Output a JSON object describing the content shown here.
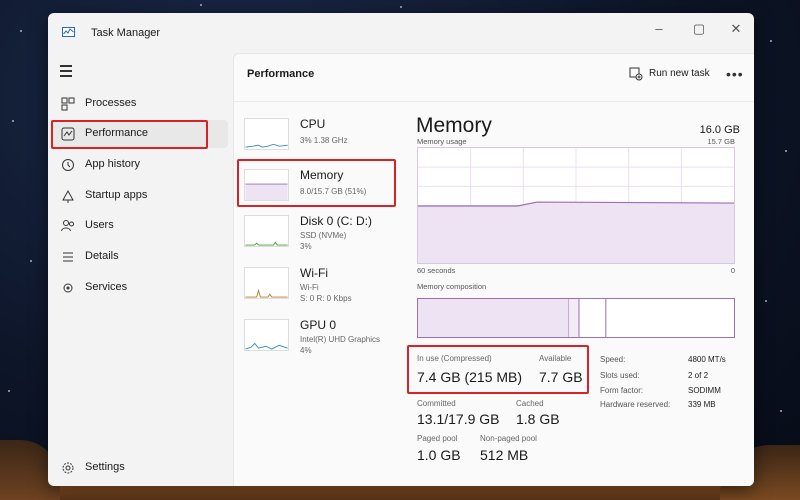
{
  "window": {
    "title": "Task Manager"
  },
  "nav": {
    "items": [
      {
        "label": "Processes",
        "icon": "processes-icon"
      },
      {
        "label": "Performance",
        "icon": "performance-icon"
      },
      {
        "label": "App history",
        "icon": "history-icon"
      },
      {
        "label": "Startup apps",
        "icon": "startup-icon"
      },
      {
        "label": "Users",
        "icon": "users-icon"
      },
      {
        "label": "Details",
        "icon": "details-icon"
      },
      {
        "label": "Services",
        "icon": "services-icon"
      }
    ],
    "settings": "Settings",
    "active": "Performance"
  },
  "header": {
    "title": "Performance",
    "run_task": "Run new task",
    "more": "•••"
  },
  "perf_list": [
    {
      "name": "CPU",
      "sub": [
        "3% 1.38 GHz"
      ]
    },
    {
      "name": "Memory",
      "sub": [
        "8.0/15.7 GB (51%)"
      ]
    },
    {
      "name": "Disk 0 (C: D:)",
      "sub": [
        "SSD (NVMe)",
        "3%"
      ]
    },
    {
      "name": "Wi-Fi",
      "sub": [
        "Wi-Fi",
        "S: 0 R: 0 Kbps"
      ]
    },
    {
      "name": "GPU 0",
      "sub": [
        "Intel(R) UHD Graphics",
        "4%"
      ]
    }
  ],
  "memory": {
    "title": "Memory",
    "total": "16.0 GB",
    "usage_label": "Memory usage",
    "usage_max": "15.7 GB",
    "time_left": "60 seconds",
    "time_right": "0",
    "composition_label": "Memory composition",
    "in_use_label": "In use (Compressed)",
    "in_use": "7.4 GB (215 MB)",
    "available_label": "Available",
    "available": "7.7 GB",
    "committed_label": "Committed",
    "committed": "13.1/17.9 GB",
    "cached_label": "Cached",
    "cached": "1.8 GB",
    "paged_label": "Paged pool",
    "paged": "1.0 GB",
    "nonpaged_label": "Non-paged pool",
    "nonpaged": "512 MB",
    "specs": [
      {
        "k": "Speed:",
        "v": "4800 MT/s"
      },
      {
        "k": "Slots used:",
        "v": "2 of 2"
      },
      {
        "k": "Form factor:",
        "v": "SODIMM"
      },
      {
        "k": "Hardware reserved:",
        "v": "339 MB"
      }
    ]
  },
  "colors": {
    "memory_purple": "#9b6fb0",
    "memory_fill": "#ede3f2",
    "cpu_blue": "#3a8fc1",
    "disk_green": "#4a9a3a",
    "wifi_orange": "#c07a2a",
    "highlight_red": "#d92128"
  }
}
